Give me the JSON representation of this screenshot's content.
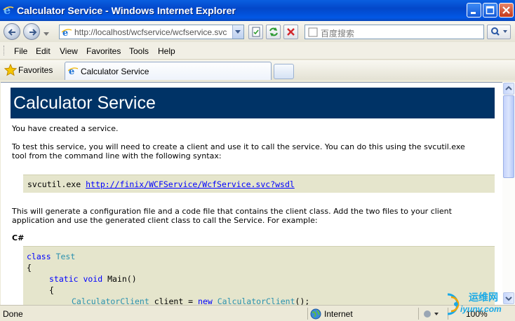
{
  "window": {
    "title": "Calculator Service - Windows Internet Explorer"
  },
  "address": {
    "url": "http://localhost/wcfservice/wcfservice.svc"
  },
  "search": {
    "placeholder": "百度搜索"
  },
  "menu": [
    "File",
    "Edit",
    "View",
    "Favorites",
    "Tools",
    "Help"
  ],
  "favorites": {
    "label": "Favorites"
  },
  "tab": {
    "title": "Calculator Service"
  },
  "page": {
    "heading": "Calculator Service",
    "p1": "You have created a service.",
    "p2_line1": "To test this service, you will need to create a client and use it to call the service. You can do this using the svcutil.exe",
    "p2_line2": "tool from the command line with the following syntax:",
    "svcutil_cmd": "svcutil.exe",
    "wsdl_link": "http://finix/WCFService/WcfService.svc?wsdl",
    "p3_line1": "This will generate a configuration file and a code file that contains the client class. Add the two files to your client",
    "p3_line2": "application and use the generated client class to call the Service. For example:",
    "lang_label": "C#",
    "code": {
      "kw_class": "class",
      "type_test": "Test",
      "brace_open": "{",
      "kw_static_void": "static void",
      "main": "Main()",
      "brace_open2": "{",
      "type_client": "CalculatorClient",
      "client_assign": " client = ",
      "kw_new": "new",
      "type_client2": "CalculatorClient",
      "ctor_end": "();"
    }
  },
  "status": {
    "text": "Done",
    "zone": "Internet",
    "zoom": "100%"
  },
  "watermark": {
    "text1": "运维网",
    "text2": "iyunv.com"
  }
}
